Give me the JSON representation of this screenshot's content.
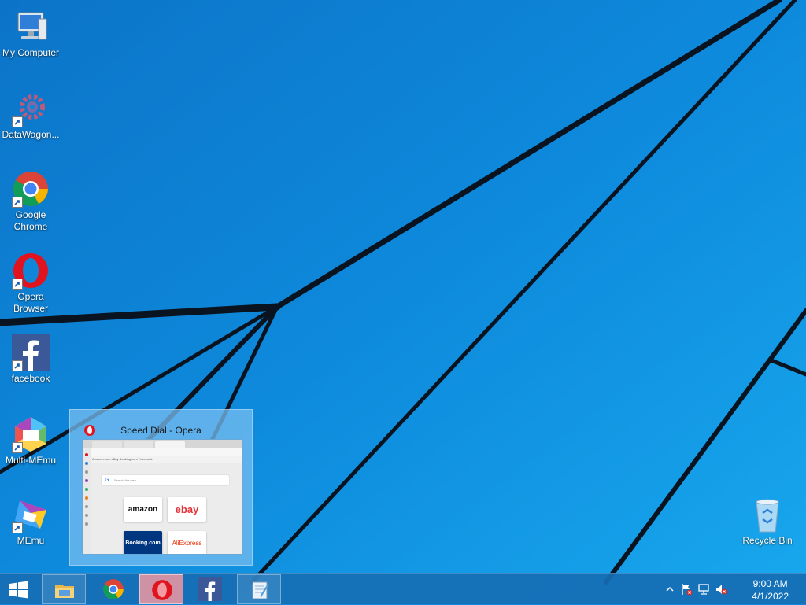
{
  "desktop": {
    "icons": [
      {
        "label": "My Computer",
        "icon": "computer-icon"
      },
      {
        "label": "DataWagon...",
        "icon": "gear-icon"
      },
      {
        "label": "Google Chrome",
        "icon": "chrome-icon"
      },
      {
        "label": "Opera Browser",
        "icon": "opera-icon"
      },
      {
        "label": "facebook",
        "icon": "facebook-icon"
      },
      {
        "label": "Multi-MEmu",
        "icon": "multi-memu-icon"
      },
      {
        "label": "MEmu",
        "icon": "memu-icon"
      },
      {
        "label": "Recycle Bin",
        "icon": "recycle-bin-icon"
      }
    ]
  },
  "thumbnail": {
    "title": "Speed Dial - Opera",
    "mini_search": "Search the web",
    "mini_bookmarks": "Amazon.com   eBay   Booking.com   Facebook",
    "tiles": [
      {
        "label": "amazon",
        "bg": "#ffffff",
        "fg": "#111111"
      },
      {
        "label": "ebay",
        "bg": "#ffffff",
        "fg": "#e53238"
      },
      {
        "label": "Booking.com",
        "bg": "#003580",
        "fg": "#ffffff"
      },
      {
        "label": "AliExpress",
        "bg": "#ffffff",
        "fg": "#e62e04"
      }
    ]
  },
  "taskbar": {
    "pinned": [
      {
        "name": "file-explorer",
        "icon": "folder-icon"
      },
      {
        "name": "chrome",
        "icon": "chrome-icon"
      },
      {
        "name": "opera",
        "icon": "opera-icon",
        "active": true
      },
      {
        "name": "facebook",
        "icon": "facebook-icon"
      },
      {
        "name": "notepad",
        "icon": "notepad-icon"
      }
    ],
    "clock": {
      "time": "9:00 AM",
      "date": "4/1/2022"
    }
  },
  "colors": {
    "wallpaper": "#0f86d8",
    "taskbar": "#166eb4",
    "opera_red": "#e0131f",
    "facebook_blue": "#3b5998"
  }
}
